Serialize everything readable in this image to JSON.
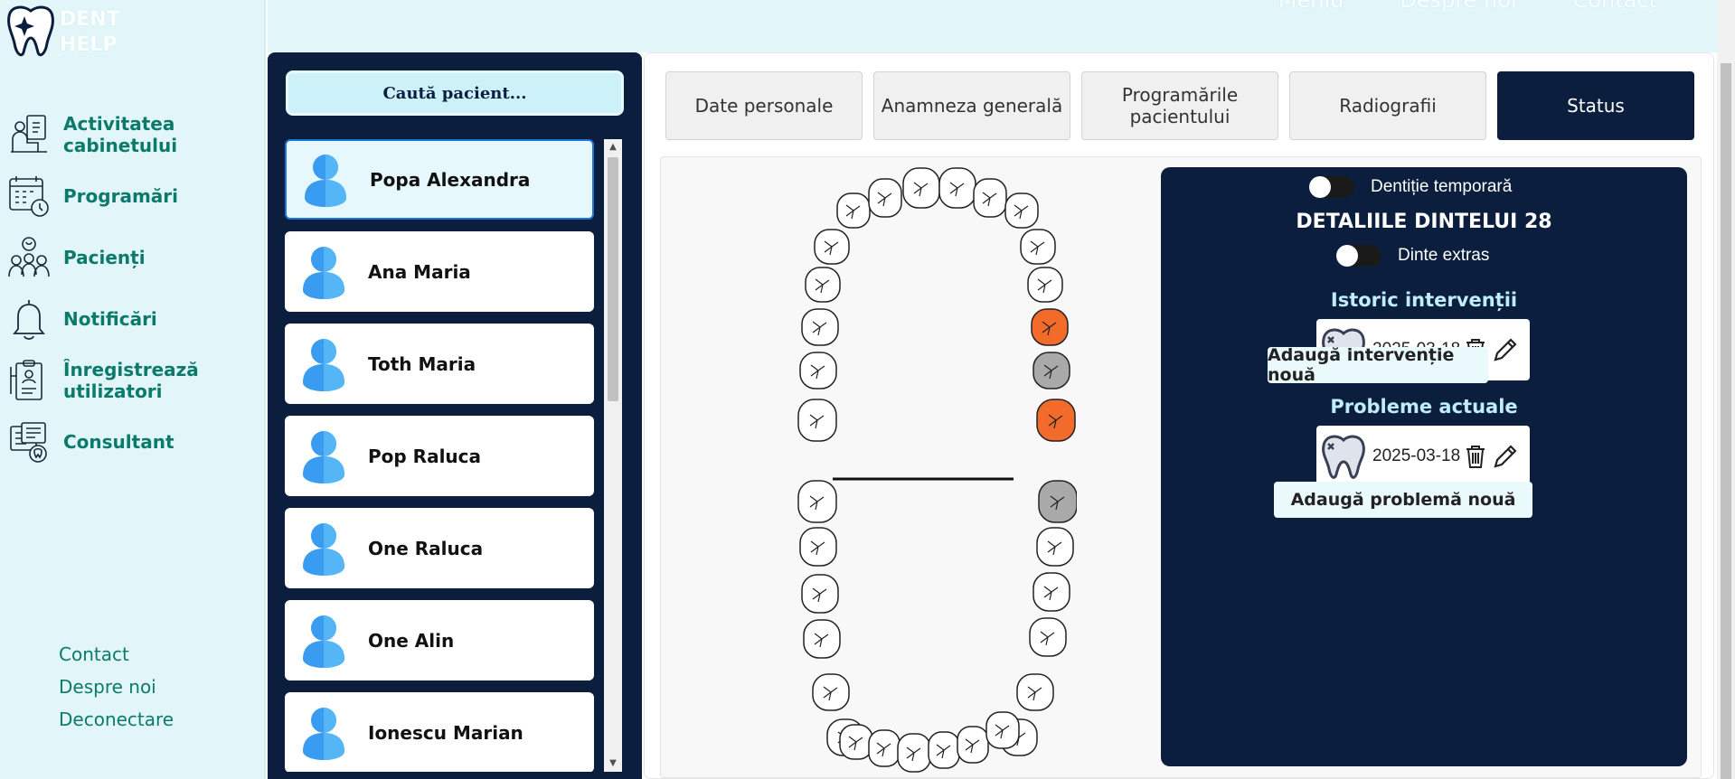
{
  "app": {
    "logo_line1": "DENT",
    "logo_line2": "HELP"
  },
  "topnav": [
    "Meniu",
    "Despre noi",
    "Contact"
  ],
  "sidebar": {
    "items": [
      {
        "label": "Activitatea cabinetului",
        "icon": "clinic-activity-icon"
      },
      {
        "label": "Programări",
        "icon": "calendar-icon"
      },
      {
        "label": "Pacienți",
        "icon": "patients-icon"
      },
      {
        "label": "Notificări",
        "icon": "bell-icon"
      },
      {
        "label": "Înregistrează utilizatori",
        "icon": "register-users-icon"
      },
      {
        "label": "Consultant",
        "icon": "consultant-icon"
      }
    ],
    "footer": [
      "Contact",
      "Despre noi",
      "Deconectare"
    ]
  },
  "patients": {
    "search_label": "Caută pacient...",
    "list": [
      "Popa Alexandra",
      "Ana Maria",
      "Toth Maria",
      "Pop Raluca",
      "One Raluca",
      "One Alin",
      "Ionescu Marian"
    ],
    "selected": "Popa Alexandra"
  },
  "tabs": [
    "Date personale",
    "Anamneza generală",
    "Programările pacientului",
    "Radiografii",
    "Status"
  ],
  "active_tab": "Status",
  "colors": {
    "navy": "#0c1e3e",
    "teal": "#0b7a6b",
    "orange": "#f26b2a",
    "gray_tooth": "#a9a9a9",
    "light_cyan": "#e2f6f9"
  },
  "details": {
    "temp_toggle_label": "Dentiție temporară",
    "title": "DETALIILE DINTELUI 28",
    "extracted_toggle_label": "Dinte extras",
    "history_title": "Istoric intervenții",
    "history_entry": {
      "date": "2025-03-18",
      "icon": "tooth-icon"
    },
    "add_intervention": "Adaugă intervenție nouă",
    "problems_title": "Probleme actuale",
    "problem_entry": {
      "date": "2025-03-18",
      "icon": "tooth-icon"
    },
    "add_problem": "Adaugă problemă nouă"
  }
}
